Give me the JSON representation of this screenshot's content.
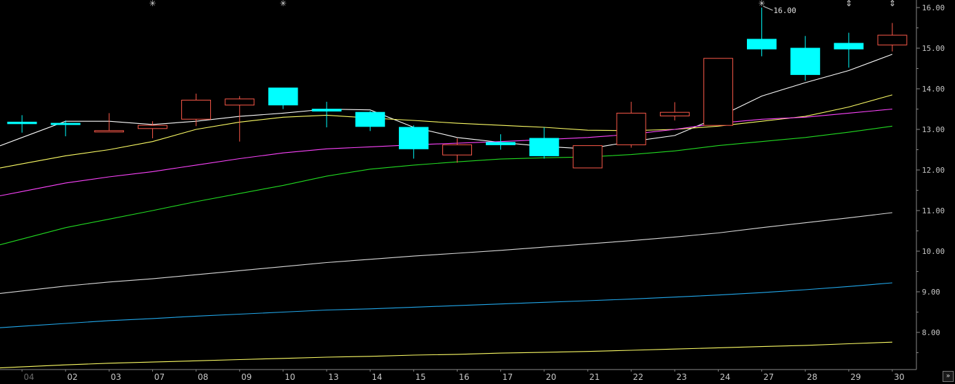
{
  "chart_data": {
    "type": "candlestick",
    "title": "",
    "xlabel": "",
    "ylabel": "",
    "ylim": [
      7.1,
      16.3
    ],
    "y_ticks": [
      8.0,
      9.0,
      10.0,
      11.0,
      12.0,
      13.0,
      14.0,
      15.0,
      16.0
    ],
    "y_tick_labels": [
      "8.00",
      "9.00",
      "10.00",
      "11.00",
      "12.00",
      "13.00",
      "14.00",
      "15.00",
      "16.00"
    ],
    "categories": [
      "04",
      "02",
      "03",
      "07",
      "08",
      "09",
      "10",
      "13",
      "14",
      "15",
      "16",
      "17",
      "20",
      "21",
      "22",
      "23",
      "24",
      "27",
      "28",
      "29",
      "30"
    ],
    "grid": false,
    "candles": [
      {
        "x": "04",
        "open": 13.18,
        "close": 13.14,
        "high": 13.35,
        "low": 12.92
      },
      {
        "x": "02",
        "open": 13.15,
        "close": 13.13,
        "high": 13.22,
        "low": 12.83
      },
      {
        "x": "03",
        "open": 12.95,
        "close": 12.97,
        "high": 13.4,
        "low": 12.95
      },
      {
        "x": "07",
        "open": 13.02,
        "close": 13.1,
        "high": 13.2,
        "low": 12.78
      },
      {
        "x": "08",
        "open": 13.25,
        "close": 13.72,
        "high": 13.88,
        "low": 13.08
      },
      {
        "x": "09",
        "open": 13.6,
        "close": 13.75,
        "high": 13.82,
        "low": 12.7
      },
      {
        "x": "10",
        "open": 14.02,
        "close": 13.6,
        "high": 14.02,
        "low": 13.5
      },
      {
        "x": "13",
        "open": 13.5,
        "close": 13.45,
        "high": 13.68,
        "low": 13.05
      },
      {
        "x": "14",
        "open": 13.42,
        "close": 13.07,
        "high": 13.45,
        "low": 12.96
      },
      {
        "x": "15",
        "open": 13.05,
        "close": 12.52,
        "high": 13.1,
        "low": 12.28
      },
      {
        "x": "16",
        "open": 12.37,
        "close": 12.62,
        "high": 12.78,
        "low": 12.18
      },
      {
        "x": "17",
        "open": 12.68,
        "close": 12.62,
        "high": 12.88,
        "low": 12.5
      },
      {
        "x": "20",
        "open": 12.78,
        "close": 12.35,
        "high": 13.05,
        "low": 12.28
      },
      {
        "x": "21",
        "open": 12.05,
        "close": 12.6,
        "high": 12.6,
        "low": 12.05
      },
      {
        "x": "22",
        "open": 12.62,
        "close": 13.4,
        "high": 13.68,
        "low": 12.55
      },
      {
        "x": "23",
        "open": 13.33,
        "close": 13.42,
        "high": 13.67,
        "low": 13.22
      },
      {
        "x": "24",
        "open": 13.1,
        "close": 14.75,
        "high": 14.75,
        "low": 13.1
      },
      {
        "x": "27",
        "open": 15.22,
        "close": 14.98,
        "high": 16.0,
        "low": 14.8
      },
      {
        "x": "28",
        "open": 15.0,
        "close": 14.35,
        "high": 15.3,
        "low": 14.2
      },
      {
        "x": "29",
        "open": 15.12,
        "close": 14.98,
        "high": 15.38,
        "low": 14.52
      },
      {
        "x": "30",
        "open": 15.08,
        "close": 15.32,
        "high": 15.62,
        "low": 14.92
      }
    ],
    "moving_averages": [
      {
        "color": "#ffffff",
        "values": [
          12.8,
          13.2,
          13.2,
          13.12,
          13.2,
          13.32,
          13.4,
          13.5,
          13.48,
          13.05,
          12.8,
          12.68,
          12.58,
          12.52,
          12.7,
          12.85,
          13.3,
          13.82,
          14.15,
          14.45,
          14.85
        ]
      },
      {
        "color": "#ffff66",
        "values": [
          12.15,
          12.35,
          12.5,
          12.7,
          13.0,
          13.18,
          13.3,
          13.35,
          13.28,
          13.22,
          13.15,
          13.1,
          13.05,
          12.98,
          12.97,
          13.0,
          13.08,
          13.2,
          13.32,
          13.55,
          13.85
        ]
      },
      {
        "color": "#ff44ff",
        "values": [
          11.47,
          11.68,
          11.83,
          11.96,
          12.12,
          12.28,
          12.42,
          12.52,
          12.57,
          12.62,
          12.66,
          12.7,
          12.75,
          12.8,
          12.88,
          13.0,
          13.15,
          13.25,
          13.3,
          13.4,
          13.5
        ]
      },
      {
        "color": "#22dd22",
        "values": [
          10.3,
          10.58,
          10.79,
          11.0,
          11.22,
          11.42,
          11.62,
          11.85,
          12.02,
          12.12,
          12.2,
          12.27,
          12.3,
          12.32,
          12.38,
          12.47,
          12.6,
          12.7,
          12.8,
          12.93,
          13.08
        ]
      },
      {
        "color": "#dcdcdc",
        "values": [
          9.02,
          9.14,
          9.24,
          9.32,
          9.42,
          9.52,
          9.62,
          9.72,
          9.8,
          9.88,
          9.95,
          10.02,
          10.1,
          10.18,
          10.26,
          10.35,
          10.45,
          10.58,
          10.7,
          10.82,
          10.95
        ]
      },
      {
        "color": "#22aaee",
        "values": [
          8.15,
          8.22,
          8.29,
          8.34,
          8.4,
          8.45,
          8.5,
          8.55,
          8.58,
          8.62,
          8.66,
          8.7,
          8.74,
          8.78,
          8.82,
          8.87,
          8.92,
          8.98,
          9.05,
          9.13,
          9.22
        ]
      },
      {
        "color": "#ffff66",
        "values": [
          7.15,
          7.2,
          7.24,
          7.27,
          7.3,
          7.33,
          7.36,
          7.39,
          7.41,
          7.44,
          7.46,
          7.49,
          7.51,
          7.53,
          7.56,
          7.59,
          7.62,
          7.65,
          7.68,
          7.72,
          7.76
        ]
      }
    ],
    "annotations": [
      {
        "x": "27",
        "y": 16.0,
        "text": "16.00"
      }
    ],
    "top_markers": [
      {
        "x": "07",
        "symbol": "✳"
      },
      {
        "x": "10",
        "symbol": "✳"
      },
      {
        "x": "27",
        "symbol": "✳"
      },
      {
        "x": "29",
        "symbol": "⇕"
      },
      {
        "x": "30",
        "symbol": "⇕"
      }
    ],
    "colors": {
      "background": "#000000",
      "up": "#ff5a4a",
      "down": "#00ffff",
      "axis": "#8a8a8a",
      "text": "#c8c8c8"
    }
  },
  "controls": {
    "scroll_label": "»"
  }
}
